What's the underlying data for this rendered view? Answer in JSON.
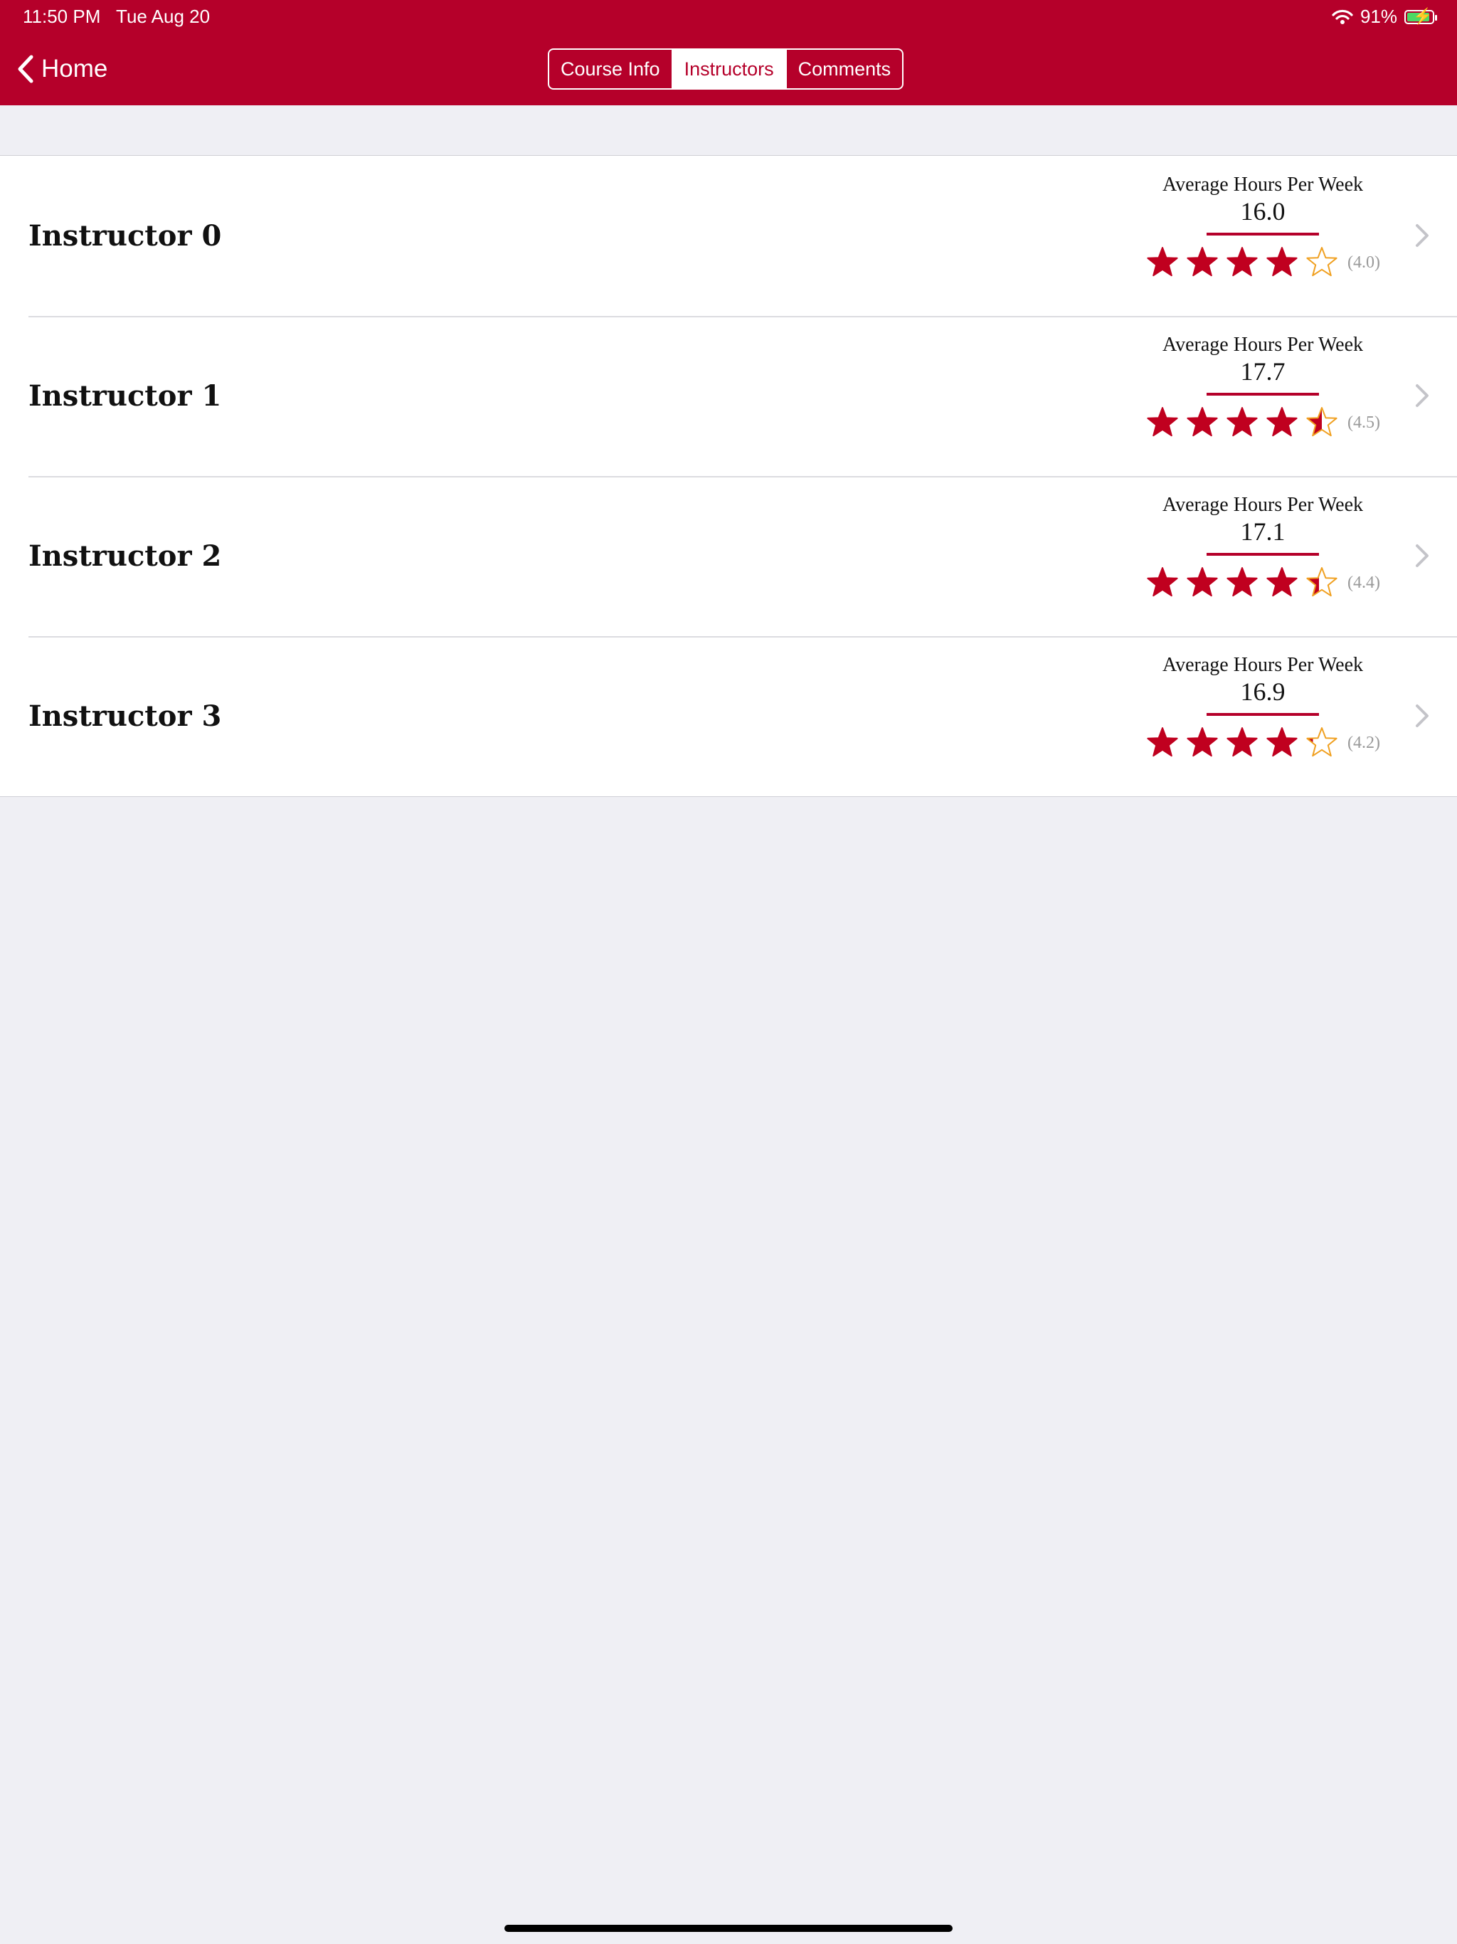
{
  "status_bar": {
    "time": "11:50 PM",
    "date": "Tue Aug 20",
    "battery_percent": "91%",
    "battery_level": 0.91,
    "wifi_icon": "wifi-icon",
    "battery_icon": "battery-charging-icon"
  },
  "nav": {
    "back_label": "Home",
    "back_icon": "chevron-left-icon",
    "tabs": [
      {
        "label": "Course Info",
        "active": false
      },
      {
        "label": "Instructors",
        "active": true
      },
      {
        "label": "Comments",
        "active": false
      }
    ]
  },
  "instructors": [
    {
      "name": "Instructor 0",
      "hours_label": "Average Hours Per Week",
      "hours": "16.0",
      "rating": 4.0,
      "rating_text": "(4.0)"
    },
    {
      "name": "Instructor 1",
      "hours_label": "Average Hours Per Week",
      "hours": "17.7",
      "rating": 4.5,
      "rating_text": "(4.5)"
    },
    {
      "name": "Instructor 2",
      "hours_label": "Average Hours Per Week",
      "hours": "17.1",
      "rating": 4.4,
      "rating_text": "(4.4)"
    },
    {
      "name": "Instructor 3",
      "hours_label": "Average Hours Per Week",
      "hours": "16.9",
      "rating": 4.2,
      "rating_text": "(4.2)"
    }
  ],
  "colors": {
    "brand": "#b5002a",
    "star_fill": "#c0001f",
    "star_outline": "#f0a020",
    "background": "#efeff4",
    "battery_fill": "#4cd964"
  }
}
